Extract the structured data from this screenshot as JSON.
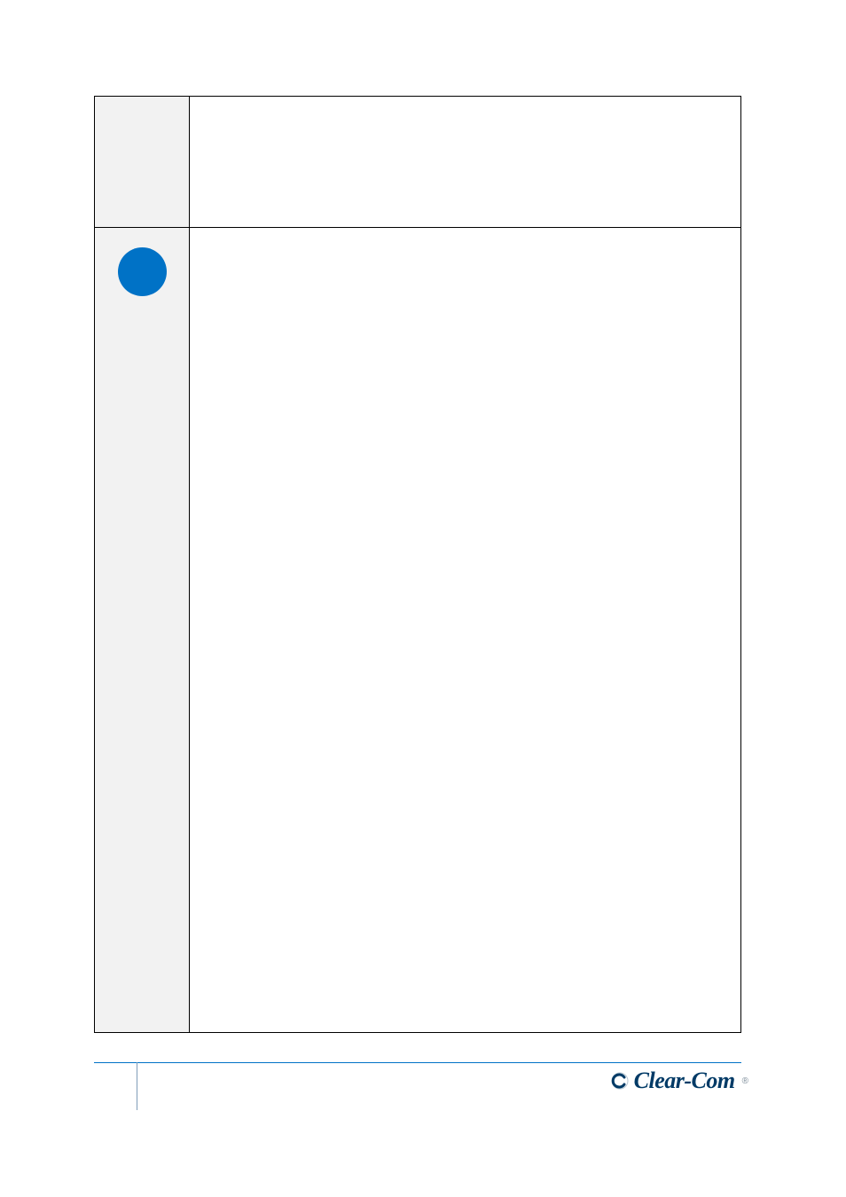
{
  "colors": {
    "accent_blue": "#0072c6",
    "brand_navy": "#003a66",
    "sidebar_gray": "#f2f2f2"
  },
  "table": {
    "rows": [
      {
        "left_marker": null
      },
      {
        "left_marker": "circle"
      }
    ]
  },
  "footer": {
    "brand_name": "Clear-Com",
    "registered_mark": "®"
  }
}
